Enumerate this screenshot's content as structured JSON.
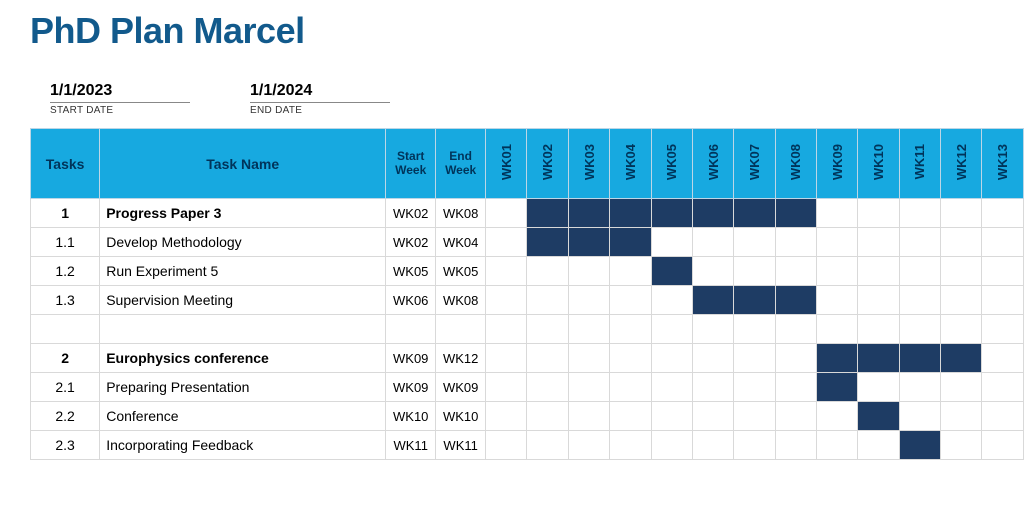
{
  "title": "PhD Plan Marcel",
  "meta": {
    "start_date": {
      "value": "1/1/2023",
      "label": "START DATE"
    },
    "end_date": {
      "value": "1/1/2024",
      "label": "END DATE"
    }
  },
  "headers": {
    "tasks": "Tasks",
    "task_name": "Task Name",
    "start_week": "Start Week",
    "end_week": "End Week"
  },
  "weeks": [
    "WK01",
    "WK02",
    "WK03",
    "WK04",
    "WK05",
    "WK06",
    "WK07",
    "WK08",
    "WK09",
    "WK10",
    "WK11",
    "WK12",
    "WK13"
  ],
  "rows": [
    {
      "id": "1",
      "name": "Progress Paper 3",
      "start": "WK02",
      "end": "WK08",
      "bold": true
    },
    {
      "id": "1.1",
      "name": "Develop Methodology",
      "start": "WK02",
      "end": "WK04",
      "bold": false
    },
    {
      "id": "1.2",
      "name": "Run Experiment 5",
      "start": "WK05",
      "end": "WK05",
      "bold": false
    },
    {
      "id": "1.3",
      "name": "Supervision Meeting",
      "start": "WK06",
      "end": "WK08",
      "bold": false
    },
    {
      "id": "",
      "name": "",
      "start": "",
      "end": "",
      "bold": false
    },
    {
      "id": "2",
      "name": "Europhysics conference",
      "start": "WK09",
      "end": "WK12",
      "bold": true
    },
    {
      "id": "2.1",
      "name": "Preparing Presentation",
      "start": "WK09",
      "end": "WK09",
      "bold": false
    },
    {
      "id": "2.2",
      "name": "Conference",
      "start": "WK10",
      "end": "WK10",
      "bold": false
    },
    {
      "id": "2.3",
      "name": "Incorporating Feedback",
      "start": "WK11",
      "end": "WK11",
      "bold": false
    }
  ],
  "chart_data": {
    "type": "bar",
    "title": "PhD Plan Marcel",
    "xlabel": "Week",
    "ylabel": "Task",
    "categories": [
      "WK01",
      "WK02",
      "WK03",
      "WK04",
      "WK05",
      "WK06",
      "WK07",
      "WK08",
      "WK09",
      "WK10",
      "WK11",
      "WK12",
      "WK13"
    ],
    "series": [
      {
        "name": "Progress Paper 3",
        "start": 2,
        "end": 8
      },
      {
        "name": "Develop Methodology",
        "start": 2,
        "end": 4
      },
      {
        "name": "Run Experiment 5",
        "start": 5,
        "end": 5
      },
      {
        "name": "Supervision Meeting",
        "start": 6,
        "end": 8
      },
      {
        "name": "Europhysics conference",
        "start": 9,
        "end": 12
      },
      {
        "name": "Preparing Presentation",
        "start": 9,
        "end": 9
      },
      {
        "name": "Conference",
        "start": 10,
        "end": 10
      },
      {
        "name": "Incorporating Feedback",
        "start": 11,
        "end": 11
      }
    ],
    "xlim": [
      1,
      13
    ]
  }
}
